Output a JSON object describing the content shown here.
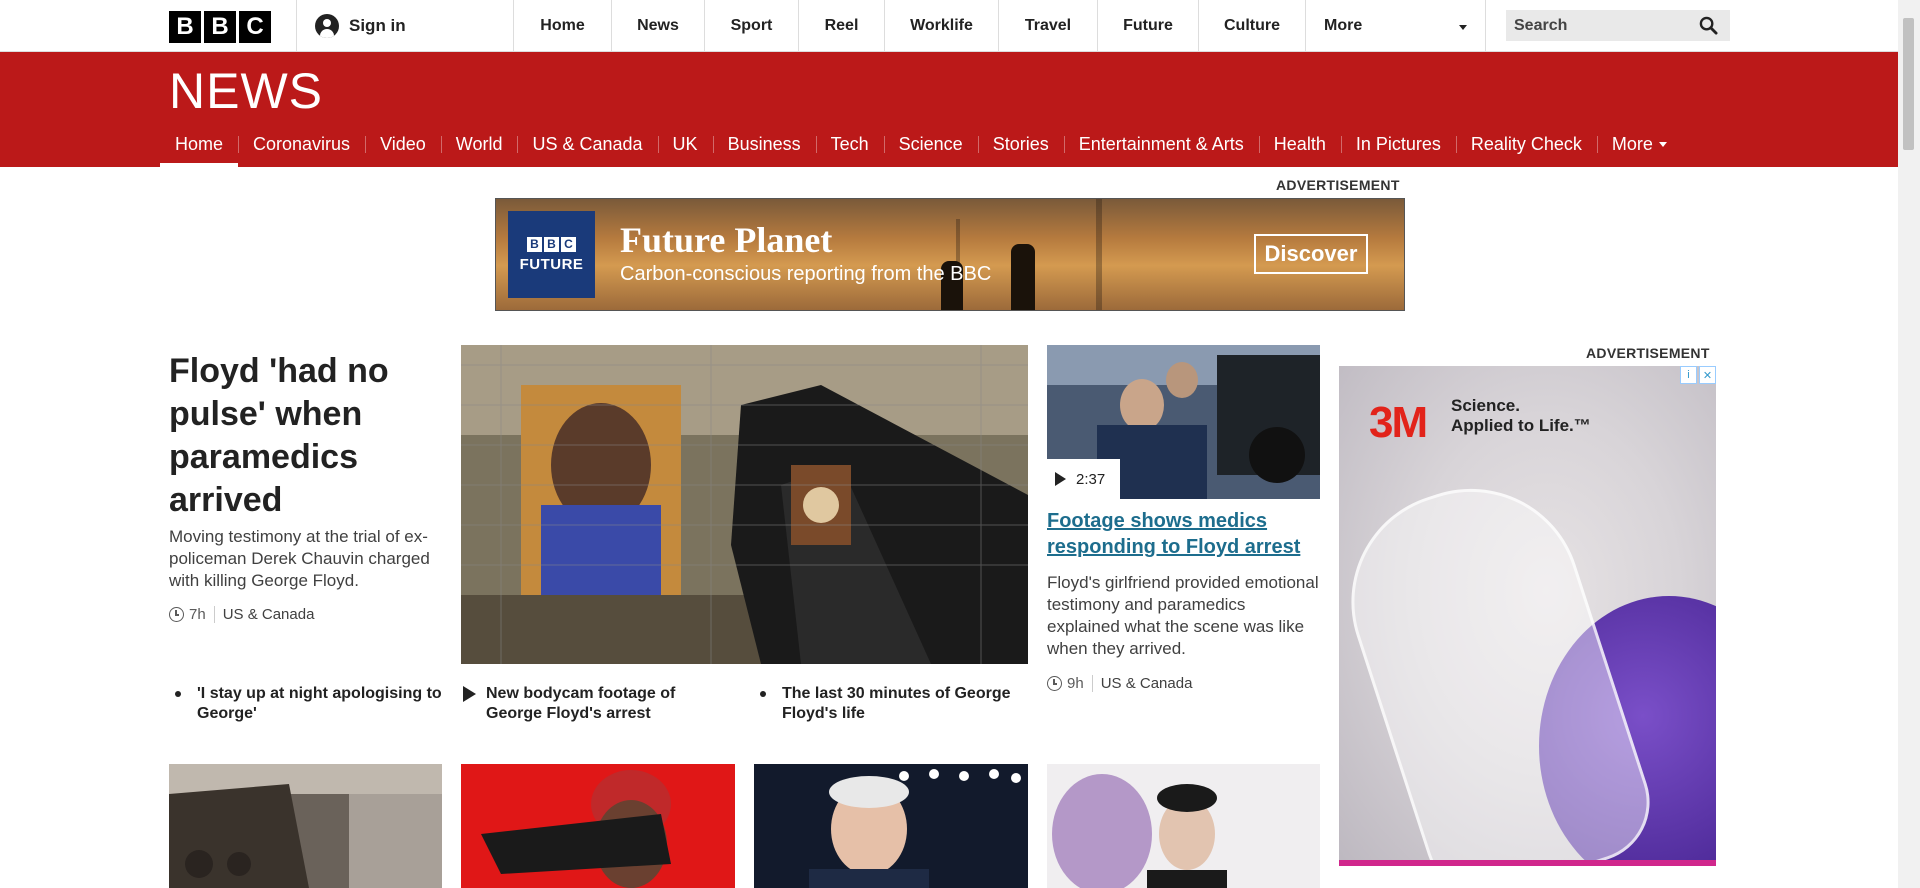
{
  "topbar": {
    "logo": [
      "B",
      "B",
      "C"
    ],
    "sign_in": "Sign in",
    "nav": [
      {
        "label": "Home",
        "w": 98
      },
      {
        "label": "News",
        "w": 93
      },
      {
        "label": "Sport",
        "w": 94
      },
      {
        "label": "Reel",
        "w": 86
      },
      {
        "label": "Worklife",
        "w": 114
      },
      {
        "label": "Travel",
        "w": 99
      },
      {
        "label": "Future",
        "w": 101
      },
      {
        "label": "Culture",
        "w": 107
      }
    ],
    "more": "More",
    "search_placeholder": "Search"
  },
  "news": {
    "logo": "NEWS",
    "nav": [
      "Home",
      "Coronavirus",
      "Video",
      "World",
      "US & Canada",
      "UK",
      "Business",
      "Tech",
      "Science",
      "Stories",
      "Entertainment & Arts",
      "Health",
      "In Pictures",
      "Reality Check"
    ],
    "nav_more": "More"
  },
  "ads": {
    "label": "ADVERTISEMENT",
    "top": {
      "brand_letters": [
        "B",
        "B",
        "C"
      ],
      "brand_name": "FUTURE",
      "title": "Future Planet",
      "subtitle": "Carbon-conscious reporting from the BBC",
      "button": "Discover"
    },
    "side": {
      "brand": "3M",
      "tagline_1": "Science.",
      "tagline_2": "Applied to Life.™",
      "choice_1": "i",
      "choice_2": "✕"
    }
  },
  "lead": {
    "headline": "Floyd 'had no pulse' when paramedics arrived",
    "summary": "Moving testimony at the trial of ex-policeman Derek Chauvin charged with killing George Floyd.",
    "time": "7h",
    "tag": "US & Canada"
  },
  "second": {
    "duration": "2:37",
    "headline": "Footage shows medics responding to Floyd arrest",
    "summary": "Floyd's girlfriend provided emotional testimony and paramedics explained what the scene was like when they arrived.",
    "time": "9h",
    "tag": "US & Canada"
  },
  "related": [
    {
      "text": "'I stay up at night apologising to George'"
    },
    {
      "text": "New bodycam footage of George Floyd's arrest"
    },
    {
      "text": "The last 30 minutes of George Floyd's life"
    }
  ],
  "colors": {
    "news_red": "#bb1919",
    "link_blue": "#1d6d8d"
  },
  "icons": [
    "user-icon",
    "caret-down-icon",
    "search-icon",
    "clock-icon",
    "play-icon",
    "ad-choices-icon"
  ]
}
